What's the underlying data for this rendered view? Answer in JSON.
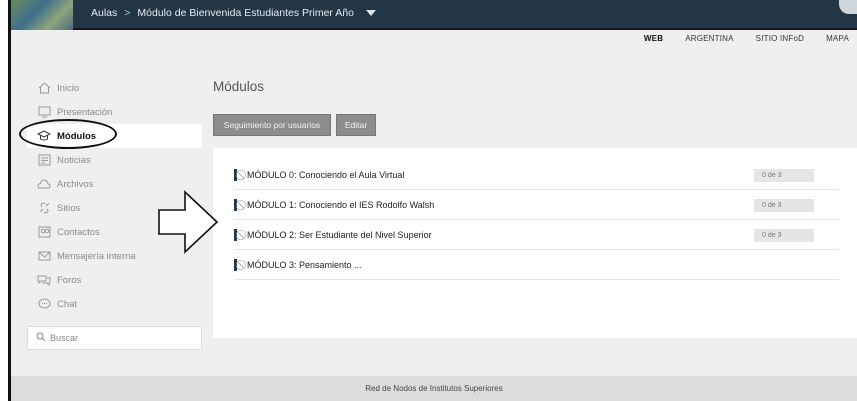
{
  "topbar": {
    "breadcrumb": [
      "Aulas",
      "Módulo de Bienvenida Estudiantes Primer Año"
    ],
    "separator": ">"
  },
  "toplinks": [
    "WEB",
    "ARGENTINA",
    "SITIO INFoD",
    "MAPA"
  ],
  "sidebar": {
    "items": [
      {
        "label": "Inicio",
        "icon": "home-icon"
      },
      {
        "label": "Presentación",
        "icon": "monitor-icon"
      },
      {
        "label": "Módulos",
        "icon": "graduation-cap-icon",
        "active": true
      },
      {
        "label": "Noticias",
        "icon": "newspaper-icon"
      },
      {
        "label": "Archivos",
        "icon": "cloud-icon"
      },
      {
        "label": "Sitios",
        "icon": "link-icon"
      },
      {
        "label": "Contactos",
        "icon": "contacts-icon"
      },
      {
        "label": "Mensajería interna",
        "icon": "envelope-icon"
      },
      {
        "label": "Foros",
        "icon": "forum-icon"
      },
      {
        "label": "Chat",
        "icon": "chat-icon"
      }
    ],
    "search_placeholder": "Buscar"
  },
  "main": {
    "title": "Módulos",
    "buttons": [
      "Seguimiento por usuarios",
      "Editar"
    ],
    "modules": [
      {
        "label": "MÓDULO 0: Conociendo el Aula Virtual",
        "progress": "0 de 3"
      },
      {
        "label": "MÓDULO 1: Conociendo el IES Rodolfo Walsh",
        "progress": "0 de 3"
      },
      {
        "label": "MÓDULO 2: Ser Estudiante del Nivel Superior",
        "progress": "0 de 3"
      },
      {
        "label": "MÓDULO 3: Pensamiento ...",
        "progress": ""
      }
    ]
  },
  "footer": {
    "text": "Red de Nodos de Institutos Superiores"
  },
  "colors": {
    "topbar": "#223646",
    "accent": "#1f3448",
    "button": "#8c8c8c"
  }
}
